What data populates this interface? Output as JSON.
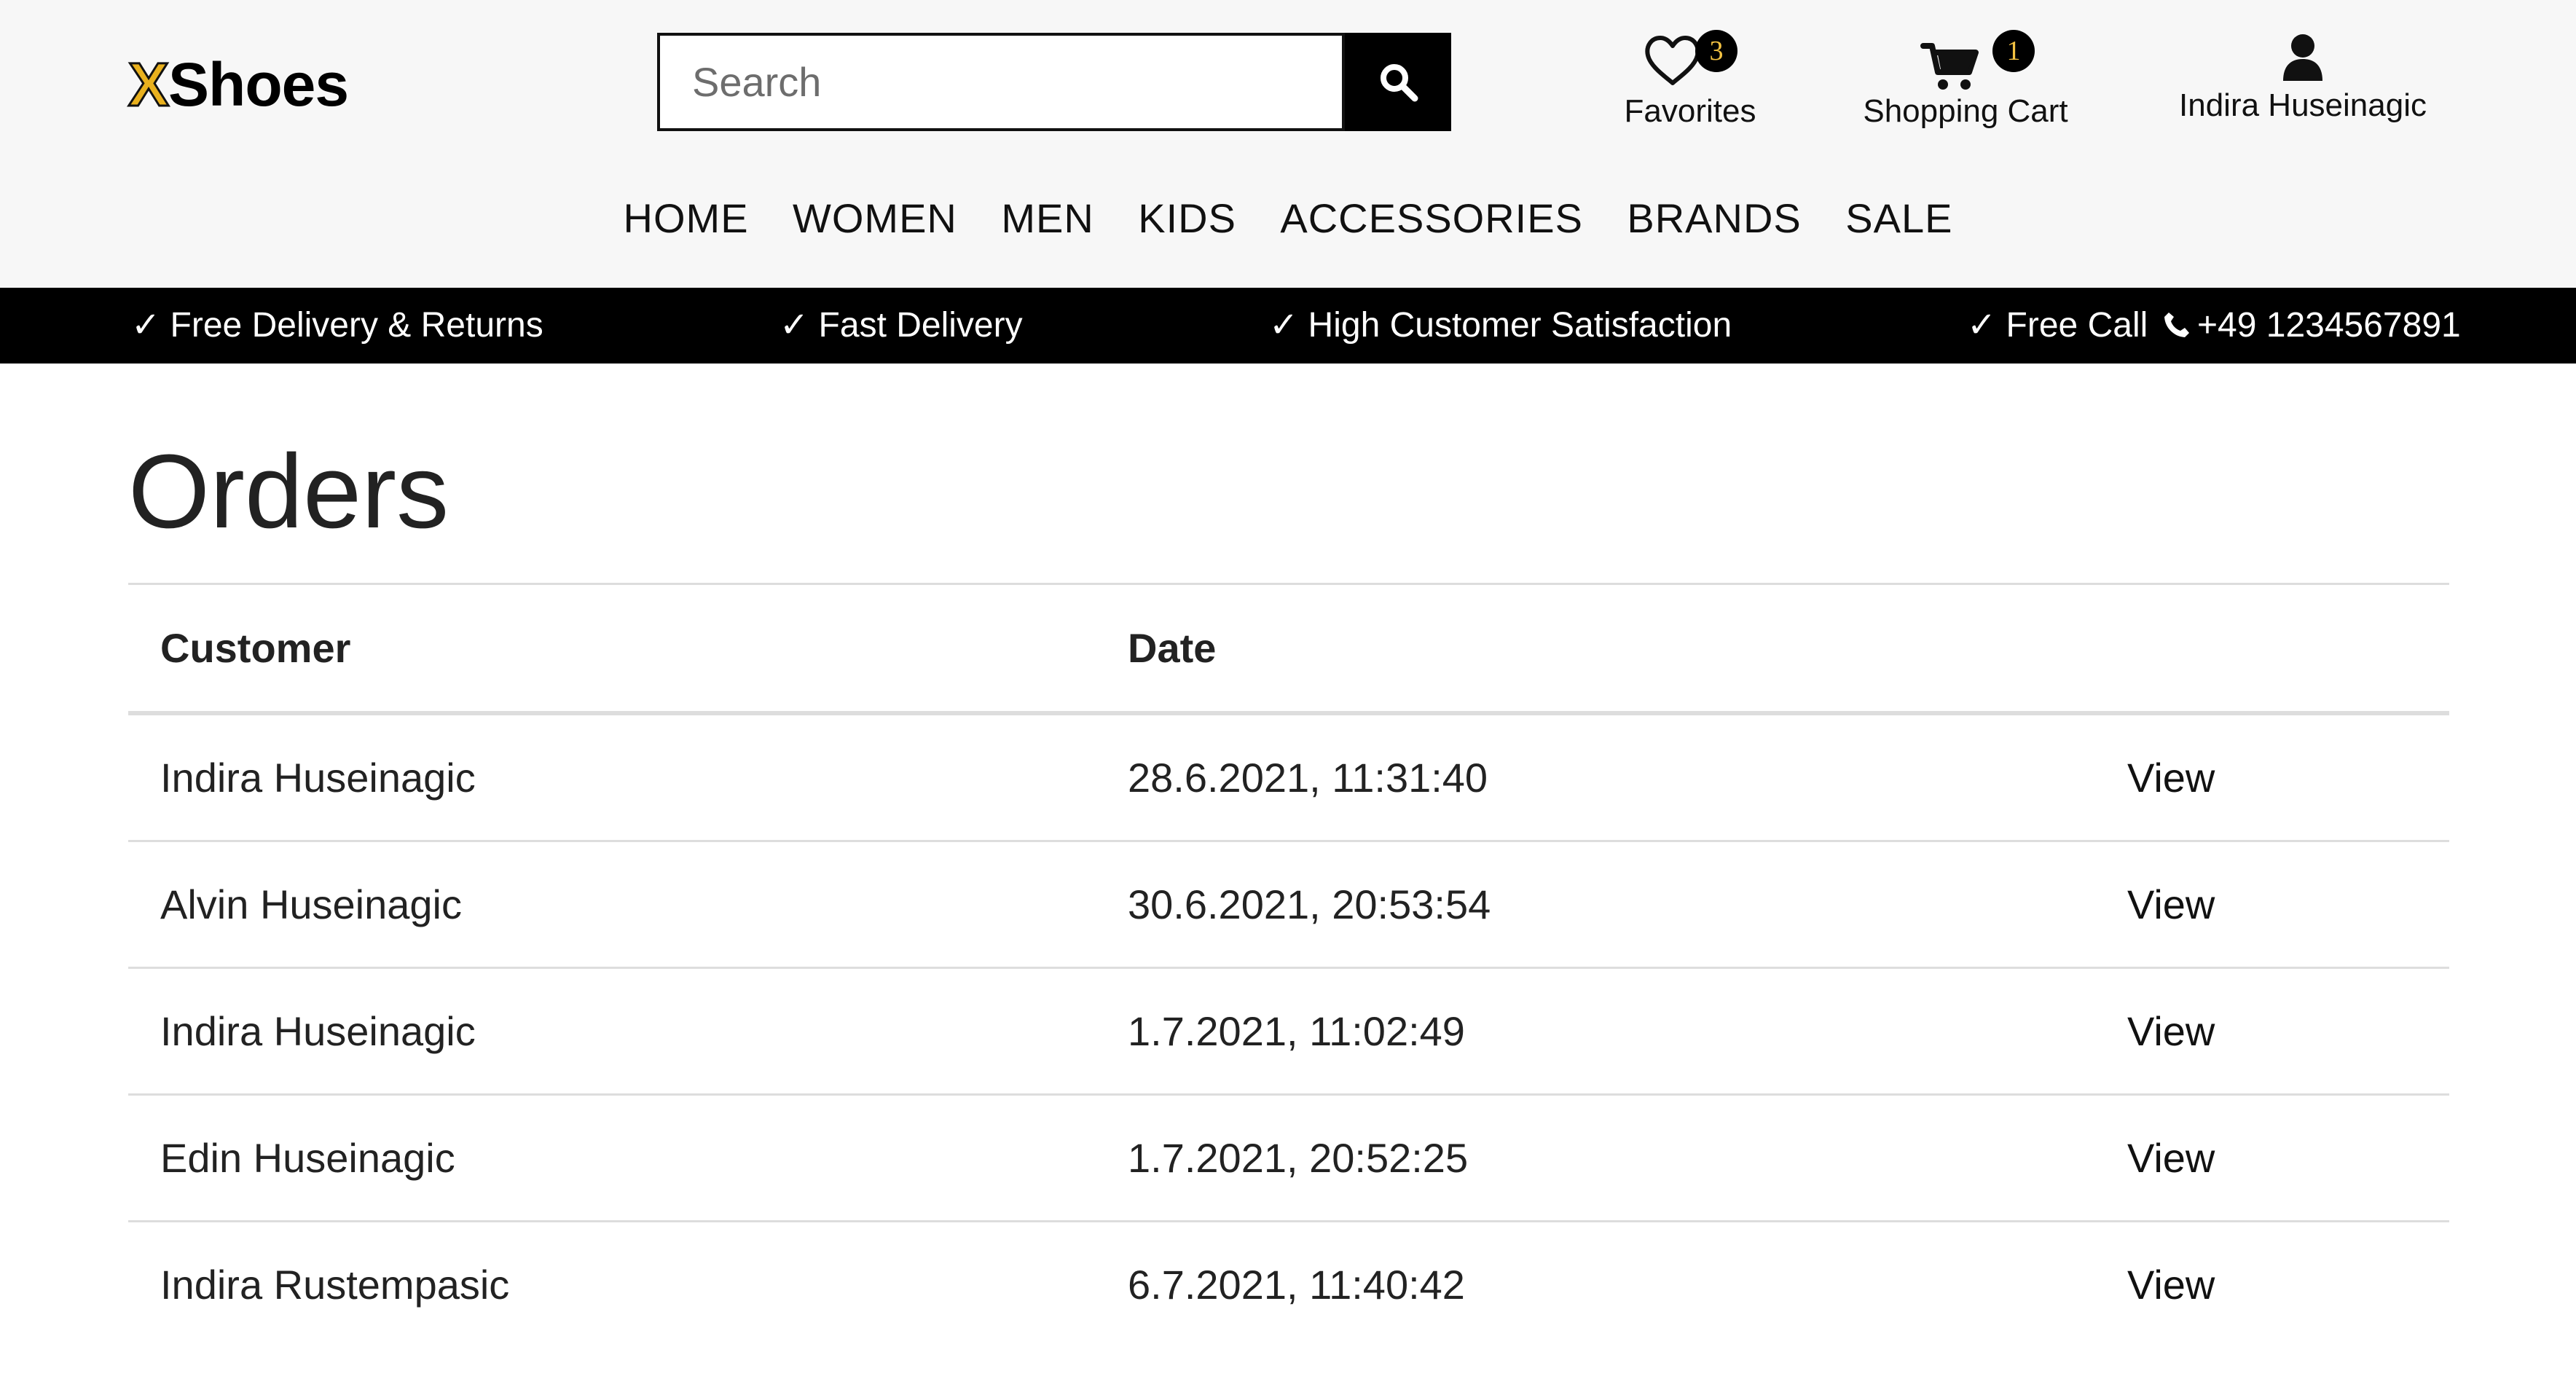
{
  "header": {
    "logo": {
      "mark": "X",
      "text": "Shoes"
    },
    "search": {
      "placeholder": "Search",
      "icon": "search-icon"
    },
    "favorites": {
      "label": "Favorites",
      "count": "3",
      "icon": "heart-icon"
    },
    "cart": {
      "label": "Shopping Cart",
      "count": "1",
      "icon": "shopping-cart-icon"
    },
    "user": {
      "label": "Indira Huseinagic",
      "icon": "user-icon"
    },
    "nav": [
      "HOME",
      "WOMEN",
      "MEN",
      "KIDS",
      "ACCESSORIES",
      "BRANDS",
      "SALE"
    ]
  },
  "benefits": [
    "✓ Free Delivery & Returns",
    "✓ Fast Delivery",
    "✓ High Customer Satisfaction",
    "✓ Free Call"
  ],
  "phone": {
    "icon": "phone-icon",
    "number": "+49 1234567891"
  },
  "orders": {
    "title": "Orders",
    "columns": {
      "customer": "Customer",
      "date": "Date"
    },
    "rows": [
      {
        "customer": "Indira Huseinagic",
        "date": "28.6.2021, 11:31:40",
        "action": "View"
      },
      {
        "customer": "Alvin Huseinagic",
        "date": "30.6.2021, 20:53:54",
        "action": "View"
      },
      {
        "customer": "Indira Huseinagic",
        "date": "1.7.2021, 11:02:49",
        "action": "View"
      },
      {
        "customer": "Edin Huseinagic",
        "date": "1.7.2021, 20:52:25",
        "action": "View"
      },
      {
        "customer": "Indira Rustempasic",
        "date": "6.7.2021, 11:40:42",
        "action": "View"
      }
    ]
  },
  "colors": {
    "brand_accent": "#e9b11e",
    "badge_text": "#f3c242",
    "header_background": "#f7f7f7",
    "benefit_bar": "#000000"
  }
}
